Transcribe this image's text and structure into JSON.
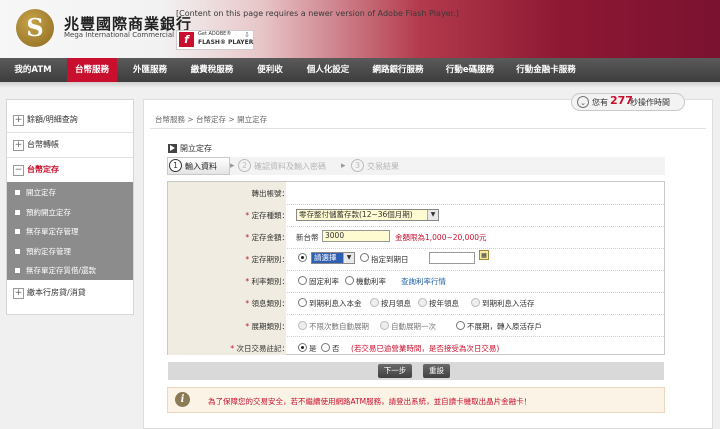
{
  "header": {
    "logo_letter": "S",
    "bank_name_zh": "兆豐國際商業銀行",
    "bank_name_en": "Mega International Commercial Bank",
    "flash_message": "[Content on this page requires a newer version of Adobe Flash Player.]",
    "flash_badge_line1": "Get ADOBE®",
    "flash_badge_line2": "FLASH® PLAYER",
    "flash_icon": "f"
  },
  "nav": {
    "items": [
      "我的ATM",
      "台幣服務",
      "外匯服務",
      "繳費稅服務",
      "便利收",
      "個人化設定",
      "網路銀行服務",
      "行動e碼服務",
      "行動金融卡服務"
    ],
    "active_index": 1
  },
  "timer": {
    "prefix": "您有",
    "seconds": "277",
    "suffix": "秒操作時間"
  },
  "sidebar": {
    "items": [
      {
        "label": "餘額/明細查詢",
        "marker": "+"
      },
      {
        "label": "台幣轉帳",
        "marker": "+"
      },
      {
        "label": "台幣定存",
        "marker": "−"
      },
      {
        "label": "繳本行房貸/消貸",
        "marker": "+"
      }
    ],
    "sub_items": [
      "開立定存",
      "預約開立定存",
      "無存單定存管理",
      "預約定存管理",
      "無存單定存質借/還款"
    ]
  },
  "breadcrumb": "台幣服務 > 台幣定存 > 開立定存",
  "page_title": "開立定存",
  "steps": [
    {
      "num": "1",
      "label": "輸入資料"
    },
    {
      "num": "2",
      "label": "確認資料及輸入密碼"
    },
    {
      "num": "3",
      "label": "交易結果"
    }
  ],
  "form": {
    "account": {
      "label": "轉出帳號：",
      "value": ""
    },
    "deposit_type": {
      "label": "定存種類：",
      "value": "零存整付儲蓄存款(12~36個月期)"
    },
    "amount": {
      "label": "定存金額：",
      "currency": "新台幣",
      "value": "3000",
      "hint": "金額限為1,000~20,000元"
    },
    "term": {
      "label": "定存期別：",
      "select_value": "請選擇",
      "maturity_label": "指定到期日",
      "maturity_value": ""
    },
    "rate_type": {
      "label": "利率類別：",
      "opt1": "固定利率",
      "opt2": "機動利率",
      "link": "查詢利率行情"
    },
    "interest": {
      "label": "領息類別：",
      "opt1": "到期利息入本金",
      "opt2": "按月領息",
      "opt3": "按年領息",
      "opt4": "到期利息入活存"
    },
    "renewal": {
      "label": "展期類別：",
      "opt1": "不限次數自動展期",
      "opt2": "自動展期一次",
      "opt3": "不展期，轉入原活存戶"
    },
    "next_day": {
      "label": "次日交易註記：",
      "yes": "是",
      "no": "否",
      "note": "(若交易已逾營業時間，是否接受為次日交易)"
    }
  },
  "buttons": {
    "next": "下一步",
    "reset": "重設"
  },
  "notice": {
    "icon": "i",
    "text": "為了保障您的交易安全，若不繼續使用網路ATM服務，請登出系統，並自讀卡機取出晶片金融卡！"
  },
  "colors": {
    "brand_red": "#c8102e",
    "nav_bg": "#4a4a4a",
    "label_bg": "#f1ece1"
  }
}
